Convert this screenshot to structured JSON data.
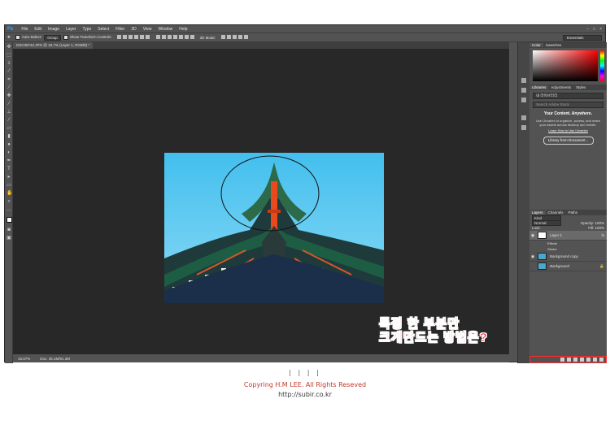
{
  "app": {
    "logo": "Ps"
  },
  "menu": [
    "File",
    "Edit",
    "Image",
    "Layer",
    "Type",
    "Select",
    "Filter",
    "3D",
    "View",
    "Window",
    "Help"
  ],
  "options": {
    "auto_select": "Auto-Select:",
    "group": "Group",
    "transform": "Show Transform Controls",
    "mode3d": "3D Mode:",
    "workspace": "Essentials"
  },
  "document": {
    "tab_title": "DSC08742.JPG @ 16.7% (Layer 1, RGB/8) *",
    "zoom": "16.67%",
    "doc_size": "Doc: 35.1M/91.3M"
  },
  "overlay": {
    "line1": "특정 한 부분만",
    "line2": "크게만드는 방법은?"
  },
  "panels": {
    "color_tabs": [
      "Color",
      "Swatches"
    ],
    "lib_tabs": [
      "Libraries",
      "Adjustments",
      "Styles"
    ],
    "library_name": "내 라이브러리",
    "search_placeholder": "Search Adobe Stock",
    "lib_heading": "Your Content. Anywhere.",
    "lib_text": "Use Libraries to organize, access, and share your assets across desktop and mobile.",
    "lib_link": "Learn How to Use Libraries",
    "lib_button": "Library from Document...",
    "layer_tabs": [
      "Layers",
      "Channels",
      "Paths"
    ],
    "kind": "Kind",
    "blend": "Normal",
    "opacity_label": "Opacity:",
    "opacity": "100%",
    "lock_label": "Lock:",
    "fill_label": "Fill:",
    "fill": "100%",
    "layers": [
      {
        "name": "Layer 1",
        "fx": "fx"
      },
      {
        "name": "Background copy"
      },
      {
        "name": "Background"
      }
    ],
    "effects_label": "Effects",
    "stroke_label": "Stroke"
  },
  "footer": {
    "separator": "| | | |",
    "copyright": "Copyring H.M LEE. All Rights Reseved",
    "url": "http://subir.co.kr"
  },
  "colors": {
    "accent": "#ff2a2a",
    "sky": "#5cc8f0"
  }
}
